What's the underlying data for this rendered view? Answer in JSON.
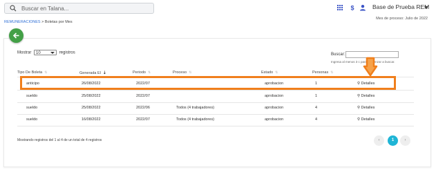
{
  "topbar": {
    "search_placeholder": "Buscar en Talana...",
    "icons": [
      "search-icon",
      "grid-icon",
      "dollar-icon",
      "user-icon"
    ],
    "org_name": "Base de Prueba REM"
  },
  "process_month": "Mes de proceso: Julio de 2022",
  "breadcrumb": {
    "root": "REMUNERACIONES",
    "sep": " > ",
    "current": "Boletas por Mes"
  },
  "table_controls": {
    "show_prefix": "Mostrar",
    "show_value": "10",
    "show_suffix": "registros",
    "search_label": "Buscar:",
    "search_hint": "Ingresa al menos 3 c                 para comenzar a buscar."
  },
  "columns": [
    "Tipo De Boleta",
    "Generada El",
    "Periodo",
    "Proceso",
    "Estado",
    "Personas"
  ],
  "rows": [
    {
      "tipo": "anticipo",
      "generada": "26/08/2022",
      "periodo": "2022/07",
      "proceso": "",
      "estado": "aprobacion",
      "personas": "1",
      "accion": "Detalles"
    },
    {
      "tipo": "sueldo",
      "generada": "25/08/2022",
      "periodo": "2022/07",
      "proceso": "",
      "estado": "aprobacion",
      "personas": "1",
      "accion": "Detalles"
    },
    {
      "tipo": "sueldo",
      "generada": "25/08/2022",
      "periodo": "2022/06",
      "proceso": "Todos (4 trabajadores)",
      "estado": "aprobacion",
      "personas": "4",
      "accion": "Detalles"
    },
    {
      "tipo": "sueldo",
      "generada": "16/08/2022",
      "periodo": "2022/07",
      "proceso": "Todos (4 trabajadores)",
      "estado": "aprobacion",
      "personas": "4",
      "accion": "Detalles"
    }
  ],
  "footer": {
    "info": "Mostrando registros del 1 al 4 de un total de 4 registros",
    "prev": "‹",
    "current_page": "1",
    "next": "›"
  },
  "colors": {
    "accent_teal": "#1fb5d6",
    "back_green": "#43a047",
    "highlight_orange": "#f07f1c"
  }
}
